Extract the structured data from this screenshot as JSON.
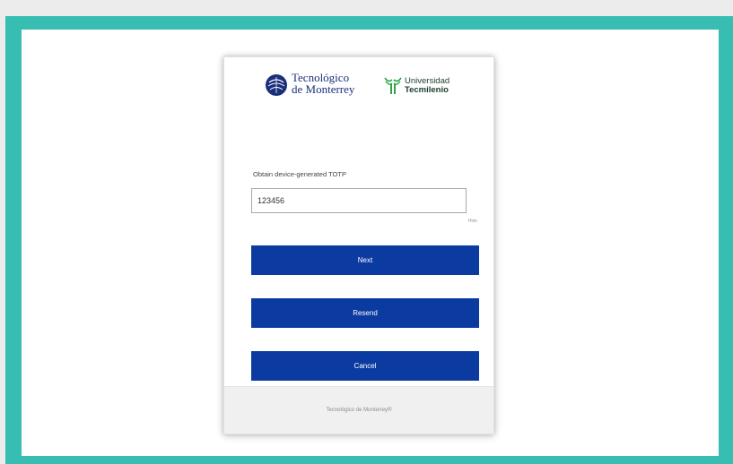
{
  "branding": {
    "tec_line1": "Tecnológico",
    "tec_line2": "de Monterrey",
    "tm_line1": "Universidad",
    "tm_line2": "Tecmilenio"
  },
  "form": {
    "label": "Obtain device-generated TOTP",
    "input_value": "123456",
    "hide_label": "Hide"
  },
  "buttons": {
    "next": "Next",
    "resend": "Resend",
    "cancel": "Cancel"
  },
  "footer": {
    "text": "Tecnológico de Monterrey®"
  },
  "colors": {
    "frame": "#37bdb1",
    "button": "#0b3aa0"
  }
}
